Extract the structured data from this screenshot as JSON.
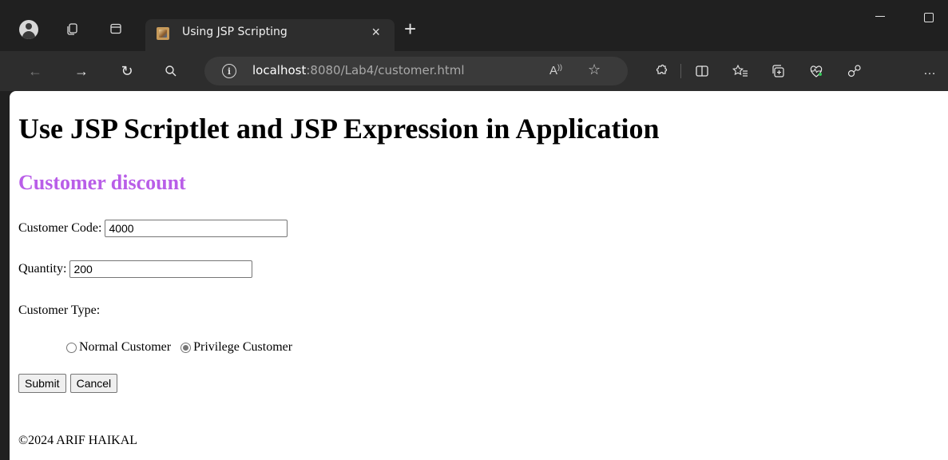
{
  "browser": {
    "tab_title": "Using JSP Scripting",
    "tab_close": "×",
    "new_tab": "+",
    "url_host": "localhost",
    "url_rest": ":8080/Lab4/customer.html",
    "icons": {
      "back": "←",
      "forward": "→",
      "refresh": "↻",
      "search": "⌕",
      "read_aloud": "A",
      "favorite": "☆",
      "extensions": "⚙",
      "split": "◫",
      "favorites": "☆",
      "collections": "⊞",
      "health": "♡",
      "copilot": "⚇",
      "more": "…"
    }
  },
  "page": {
    "title": "Use JSP Scriptlet and JSP Expression in Application",
    "subtitle": "Customer discount",
    "customer_code_label": "Customer Code:",
    "customer_code_value": "4000",
    "quantity_label": "Quantity:",
    "quantity_value": "200",
    "customer_type_label": "Customer Type:",
    "radio_normal_label": "Normal Customer",
    "radio_privilege_label": "Privilege Customer",
    "selected_type": "Privilege Customer",
    "submit_label": "Submit",
    "cancel_label": "Cancel",
    "footer": "©2024 ARIF HAIKAL"
  },
  "colors": {
    "subtitle": "#b95ee8",
    "chrome_bg": "#202020",
    "toolbar_bg": "#2d2d2d"
  }
}
